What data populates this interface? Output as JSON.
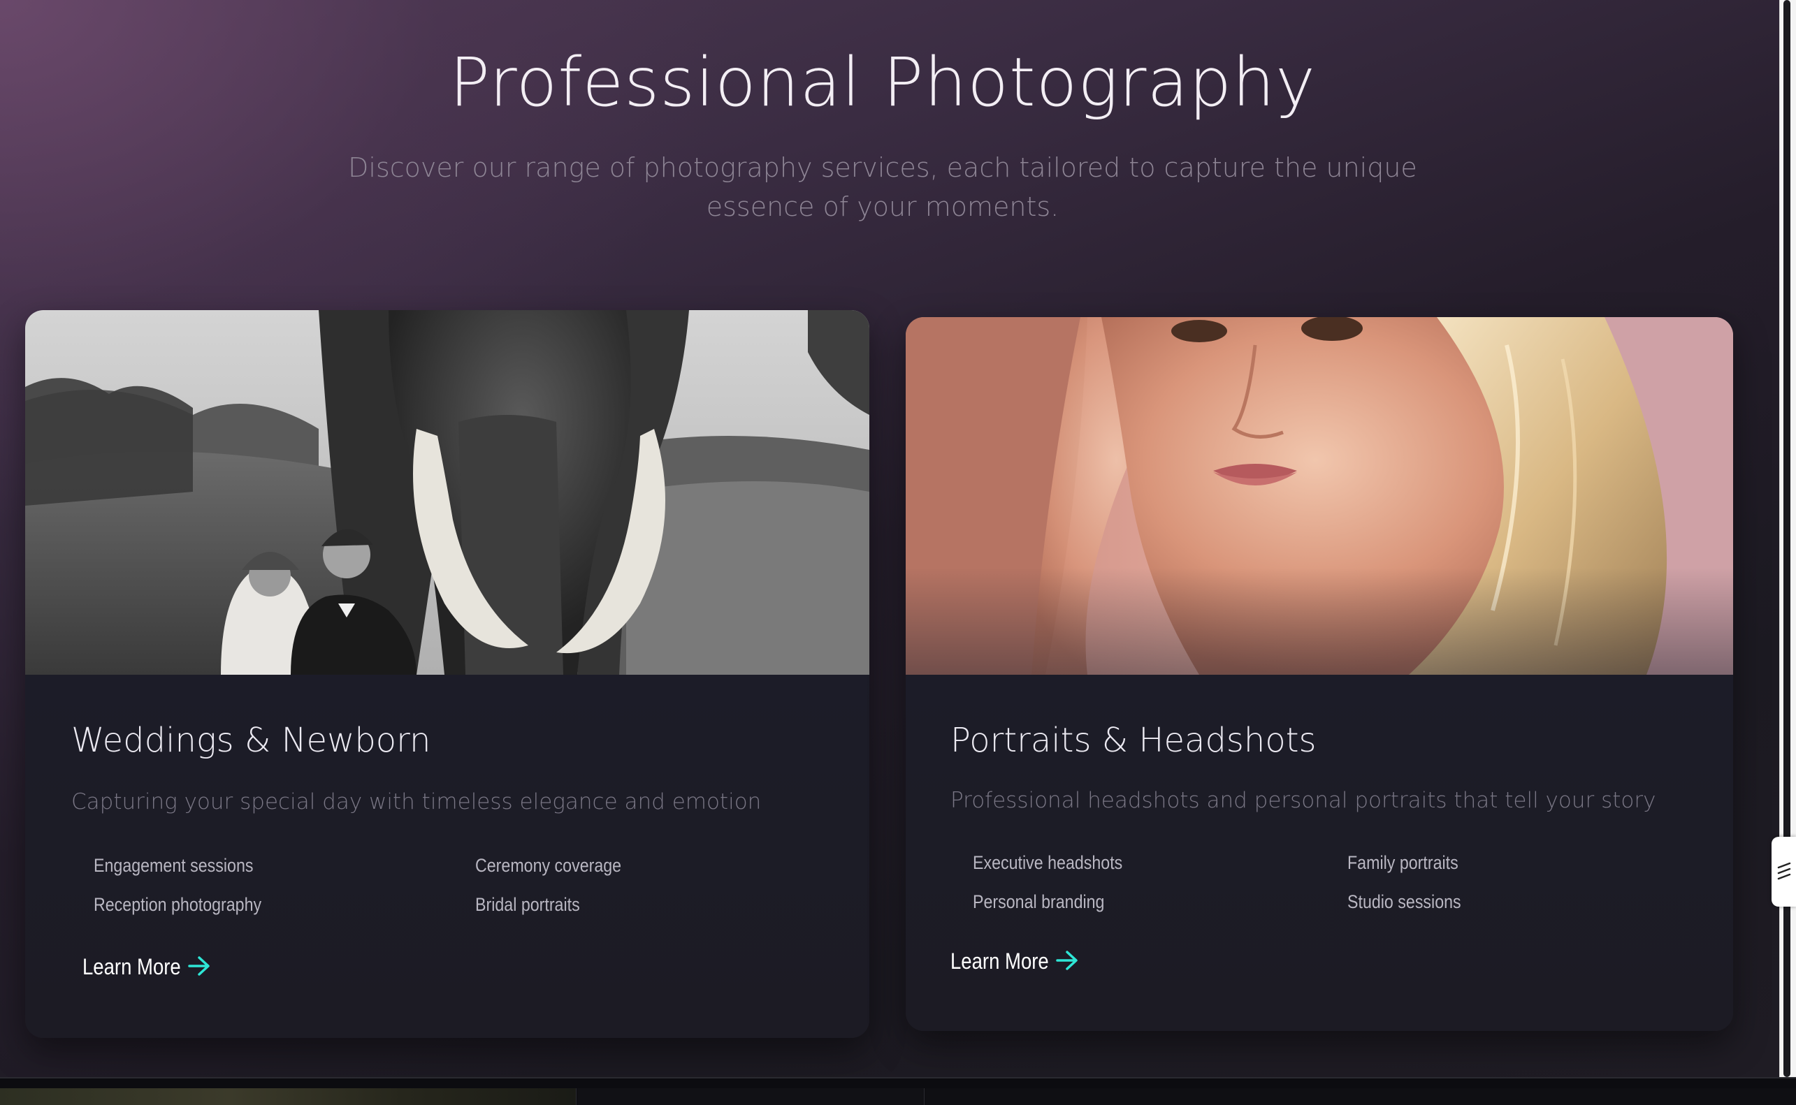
{
  "section": {
    "title": "Professional Photography",
    "subtitle": "Discover our range of photography services, each tailored to capture the unique essence of your moments."
  },
  "cards": [
    {
      "title": "Weddings & Newborn",
      "description": "Capturing your special day with timeless elegance and emotion",
      "features": [
        "Engagement sessions",
        "Ceremony coverage",
        "Reception photography",
        "Bridal portraits"
      ],
      "cta_label": "Learn More",
      "image_alt": "Black and white photo of a wedding couple in front of an elephant"
    },
    {
      "title": "Portraits & Headshots",
      "description": "Professional headshots and personal portraits that tell your story",
      "features": [
        "Executive headshots",
        "Family portraits",
        "Personal branding",
        "Studio sessions"
      ],
      "cta_label": "Learn More",
      "image_alt": "Close-up portrait of a blonde woman"
    }
  ],
  "colors": {
    "accent_arrow": "#2ee6d6",
    "card_bg": "#1d1f2c",
    "heading": "#f3eef4",
    "muted_text": "#7a7785"
  },
  "icons": {
    "cta_icon": "arrow-right-icon",
    "side_tab_icon": "collapse-icon"
  }
}
